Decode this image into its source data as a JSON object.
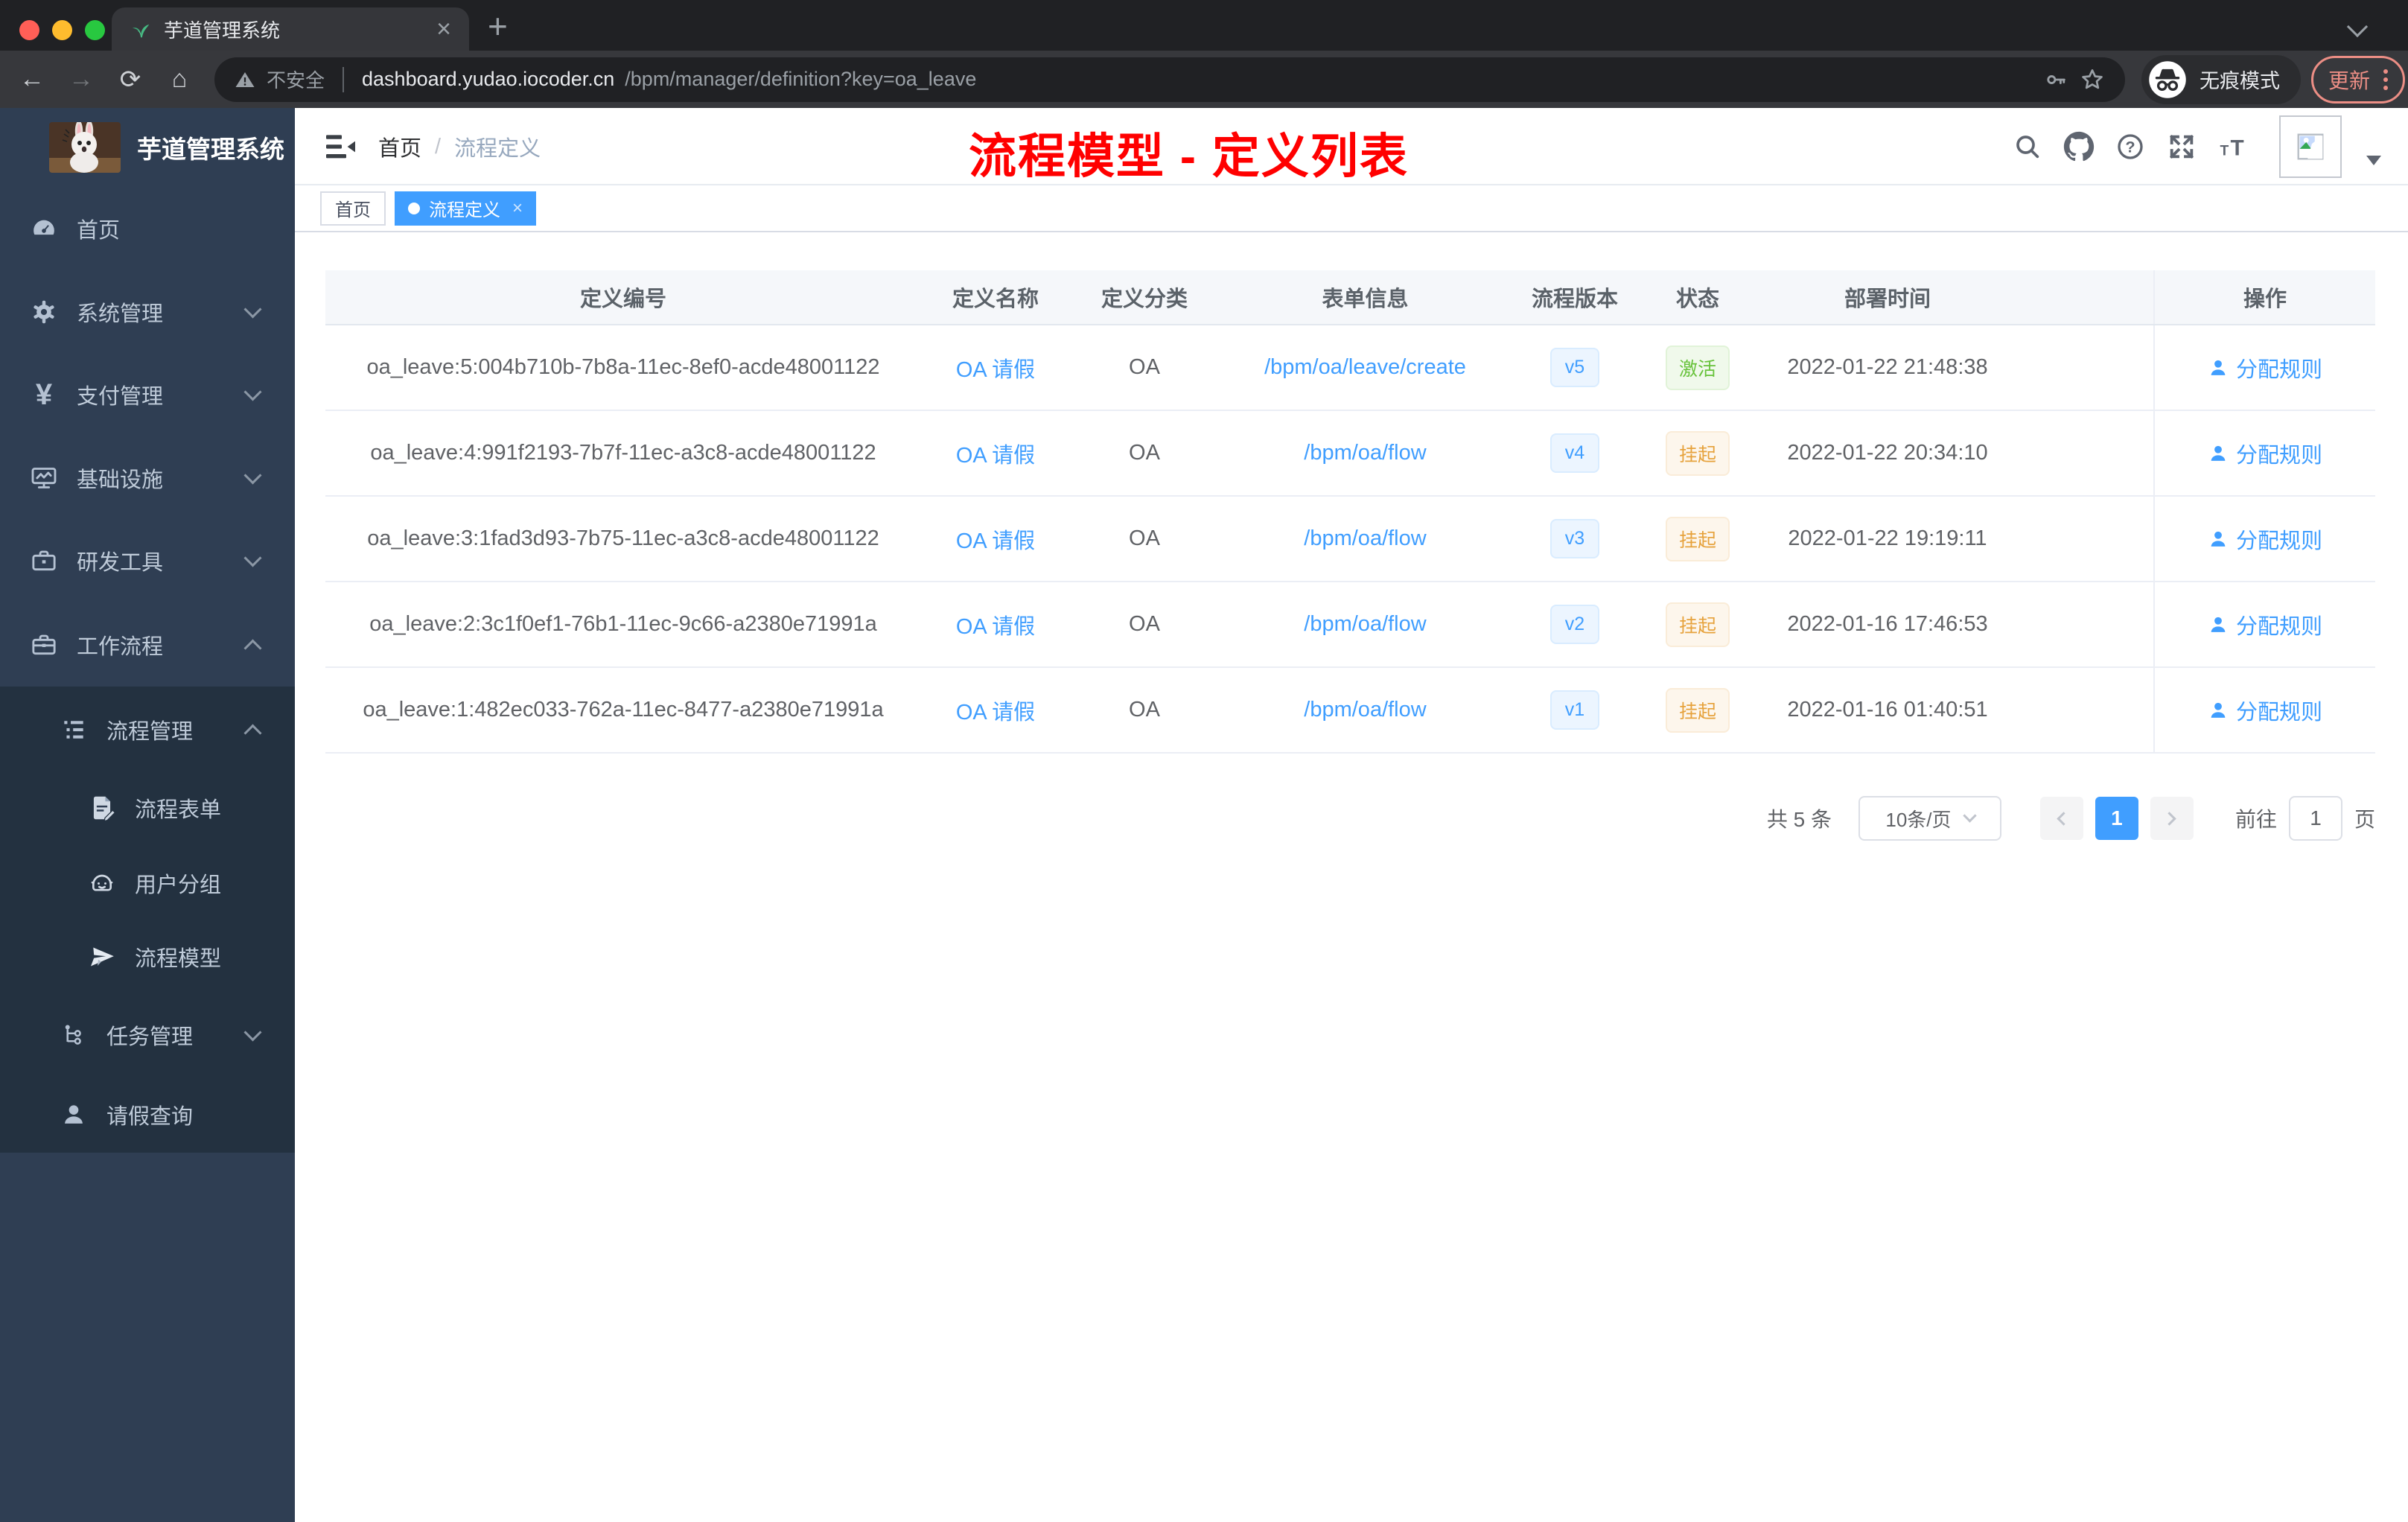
{
  "colors": {
    "accent_blue": "#409eff",
    "success_green": "#67c23a",
    "warning_orange": "#e6a23c",
    "annotation_red": "#ff0000",
    "sidebar_bg": "#2f3e53",
    "sidebar_submenu_bg": "#233140",
    "chrome_bg": "#202124",
    "toolbar_bg": "#37383c",
    "update_salmon": "#ec8e85",
    "traffic_red": "#ff5f57",
    "traffic_yellow": "#febc2e",
    "traffic_green": "#28c840"
  },
  "browser": {
    "tab_title": "芋道管理系统",
    "tab_close": "×",
    "new_tab": "+",
    "back": "←",
    "forward": "→",
    "reload": "⟳",
    "home": "⌂",
    "url": {
      "security_label": "不安全",
      "host": "dashboard.yudao.iocoder.cn",
      "path": "/bpm/manager/definition?key=oa_leave"
    },
    "incognito_label": "无痕模式",
    "update_label": "更新"
  },
  "sidebar": {
    "app_title": "芋道管理系统",
    "items": [
      {
        "label": "首页",
        "icon": "dashboard-icon",
        "level": 1
      },
      {
        "label": "系统管理",
        "icon": "gear-icon",
        "level": 1,
        "chevron": "down"
      },
      {
        "label": "支付管理",
        "icon": "yen-icon",
        "yen": "¥",
        "level": 1,
        "chevron": "down"
      },
      {
        "label": "基础设施",
        "icon": "monitor-icon",
        "level": 1,
        "chevron": "down"
      },
      {
        "label": "研发工具",
        "icon": "toolbox-icon",
        "level": 1,
        "chevron": "down"
      },
      {
        "label": "工作流程",
        "icon": "briefcase-icon",
        "level": 1,
        "chevron": "up"
      },
      {
        "label": "流程管理",
        "icon": "tree-list-icon",
        "level": 2,
        "chevron": "up"
      },
      {
        "label": "流程表单",
        "icon": "form-icon",
        "level": 3
      },
      {
        "label": "用户分组",
        "icon": "robot-icon",
        "level": 3
      },
      {
        "label": "流程模型",
        "icon": "paper-plane-icon",
        "level": 3
      },
      {
        "label": "任务管理",
        "icon": "org-tree-icon",
        "level": 2,
        "chevron": "down"
      },
      {
        "label": "请假查询",
        "icon": "user-icon",
        "level": 2
      }
    ]
  },
  "header": {
    "breadcrumb": {
      "home": "首页",
      "separator": "/",
      "current": "流程定义"
    },
    "annotation": "流程模型 - 定义列表",
    "icons": [
      "search-icon",
      "github-icon",
      "help-icon",
      "fullscreen-icon",
      "font-size-icon",
      "avatar",
      "caret-down-icon"
    ]
  },
  "tags": [
    {
      "label": "首页",
      "active": false
    },
    {
      "label": "流程定义",
      "active": true,
      "close": "×"
    }
  ],
  "table": {
    "columns": [
      "定义编号",
      "定义名称",
      "定义分类",
      "表单信息",
      "流程版本",
      "状态",
      "部署时间",
      "操作"
    ],
    "rows": [
      {
        "id": "oa_leave:5:004b710b-7b8a-11ec-8ef0-acde48001122",
        "name": "OA 请假",
        "category": "OA",
        "form": "/bpm/oa/leave/create",
        "version": "v5",
        "status": "激活",
        "status_type": "success",
        "time": "2022-01-22 21:48:38",
        "action": "分配规则"
      },
      {
        "id": "oa_leave:4:991f2193-7b7f-11ec-a3c8-acde48001122",
        "name": "OA 请假",
        "category": "OA",
        "form": "/bpm/oa/flow",
        "version": "v4",
        "status": "挂起",
        "status_type": "warning",
        "time": "2022-01-22 20:34:10",
        "action": "分配规则"
      },
      {
        "id": "oa_leave:3:1fad3d93-7b75-11ec-a3c8-acde48001122",
        "name": "OA 请假",
        "category": "OA",
        "form": "/bpm/oa/flow",
        "version": "v3",
        "status": "挂起",
        "status_type": "warning",
        "time": "2022-01-22 19:19:11",
        "action": "分配规则"
      },
      {
        "id": "oa_leave:2:3c1f0ef1-76b1-11ec-9c66-a2380e71991a",
        "name": "OA 请假",
        "category": "OA",
        "form": "/bpm/oa/flow",
        "version": "v2",
        "status": "挂起",
        "status_type": "warning",
        "time": "2022-01-16 17:46:53",
        "action": "分配规则"
      },
      {
        "id": "oa_leave:1:482ec033-762a-11ec-8477-a2380e71991a",
        "name": "OA 请假",
        "category": "OA",
        "form": "/bpm/oa/flow",
        "version": "v1",
        "status": "挂起",
        "status_type": "warning",
        "time": "2022-01-16 01:40:51",
        "action": "分配规则"
      }
    ]
  },
  "pagination": {
    "total": "共 5 条",
    "page_size": "10条/页",
    "current": "1",
    "goto_label": "前往",
    "goto_value": "1",
    "page_label": "页"
  }
}
